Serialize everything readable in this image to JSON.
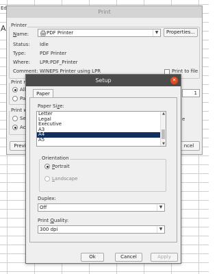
{
  "sheet": {
    "edit_fragment": "Edi",
    "a_fragment": "A"
  },
  "print_dialog": {
    "title": "Print",
    "printer_group": "Printer",
    "name_label": "Name:",
    "printer_name": "PDF Printer",
    "properties_label": "Properties...",
    "status_label": "Status:",
    "status_value": "Idle",
    "type_label": "Type:",
    "type_value": "PDF Printer",
    "where_label": "Where:",
    "where_value": "LPR:PDF_Printer",
    "comment_label": "Comment:",
    "comment_value": "WINEPS Printer using LPR",
    "print_to_file": "Print to file",
    "print_range_group": "Print ra",
    "range_all": "All",
    "range_pages": "Pag",
    "print_what_group": "Print wh",
    "what_selection": "Sele",
    "what_active": "Acti",
    "preview_button": "Previ",
    "cancel_button": "ncel",
    "copies_value": "1",
    "collate_letter": "e"
  },
  "setup_dialog": {
    "title": "Setup",
    "close_icon": "close-icon",
    "tab_paper": "Paper",
    "paper_size_label": "Paper Size:",
    "paper_sizes": [
      "Letter",
      "Legal",
      "Executive",
      "A3",
      "A4",
      "A5"
    ],
    "selected_paper": "A4",
    "orientation_group": "Orientation",
    "portrait": "Portrait",
    "landscape": "Landscape",
    "duplex_label": "Duplex:",
    "duplex_value": "Off",
    "quality_label": "Print Quality:",
    "quality_value": "300 dpi",
    "ok": "Ok",
    "cancel": "Cancel",
    "apply": "Apply"
  }
}
